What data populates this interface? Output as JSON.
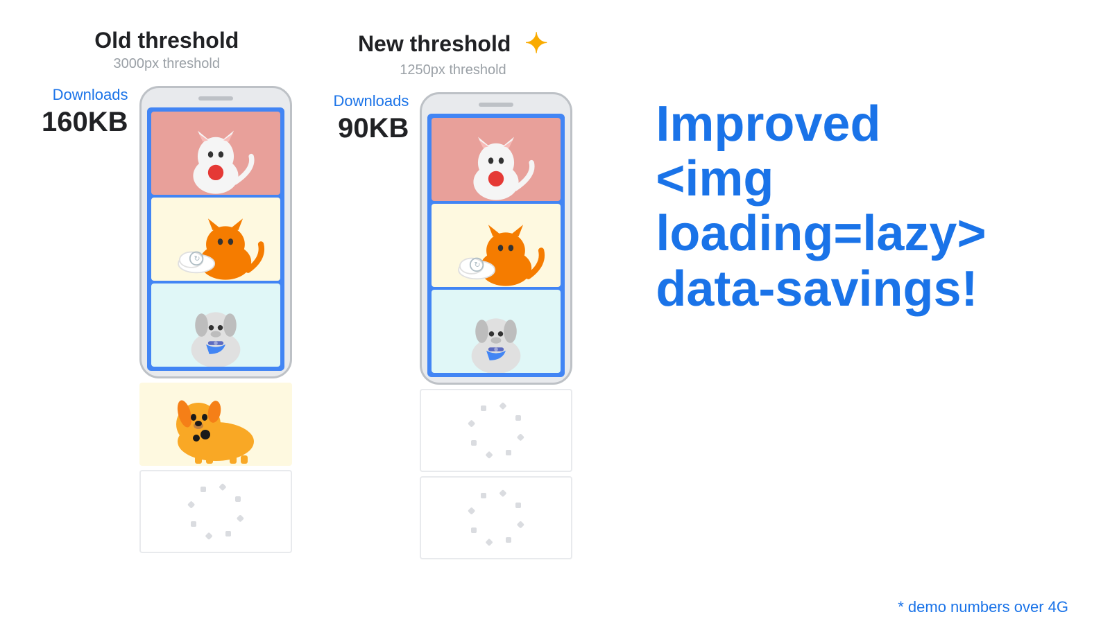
{
  "left": {
    "threshold_title": "Old threshold",
    "threshold_sub": "3000px threshold",
    "downloads_label": "Downloads",
    "downloads_size": "160KB"
  },
  "right": {
    "threshold_title": "New threshold",
    "threshold_sub": "1250px threshold",
    "downloads_label": "Downloads",
    "downloads_size": "90KB"
  },
  "main_text": {
    "line1": "Improved",
    "line2": "<img loading=lazy>",
    "line3": "data-savings!"
  },
  "demo_note": "* demo numbers over 4G",
  "colors": {
    "accent_blue": "#1a73e8",
    "title_dark": "#202124",
    "subtitle_gray": "#9aa0a6",
    "sparkle_gold": "#f9ab00"
  }
}
